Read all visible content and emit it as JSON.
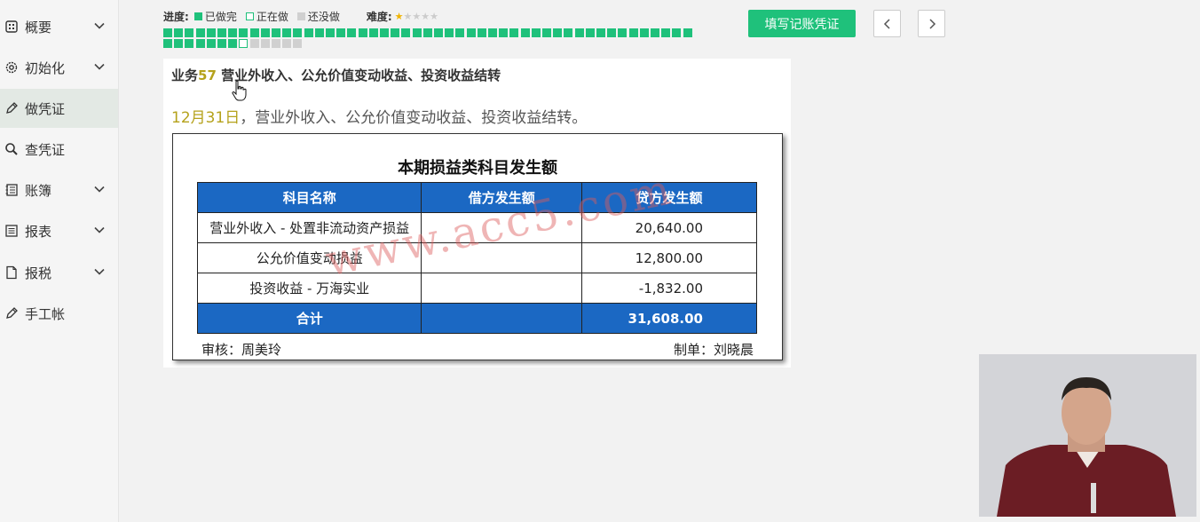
{
  "sidebar": {
    "items": [
      {
        "label": "概要",
        "icon": "overview-icon",
        "expandable": true
      },
      {
        "label": "初始化",
        "icon": "gear-icon",
        "expandable": true
      },
      {
        "label": "做凭证",
        "icon": "pen-icon",
        "expandable": false,
        "active": true
      },
      {
        "label": "查凭证",
        "icon": "search-icon",
        "expandable": false
      },
      {
        "label": "账簿",
        "icon": "ledger-icon",
        "expandable": true
      },
      {
        "label": "报表",
        "icon": "report-icon",
        "expandable": true
      },
      {
        "label": "报税",
        "icon": "document-icon",
        "expandable": true
      },
      {
        "label": "手工帐",
        "icon": "pen-icon",
        "expandable": false
      }
    ]
  },
  "progress": {
    "label": "进度:",
    "done_label": "已做完",
    "current_label": "正在做",
    "todo_label": "还没做",
    "difficulty_label": "难度:",
    "difficulty_stars": 1,
    "difficulty_max": 5,
    "total": 62,
    "done": 56,
    "current_index": 57,
    "colors": {
      "done": "#1fc17b",
      "todo": "#d0d0d0"
    }
  },
  "toolbar": {
    "fill_voucher_label": "填写记账凭证"
  },
  "task": {
    "title_prefix": "业务",
    "number": "57",
    "title_rest": " 营业外收入、公允价值变动收益、投资收益结转",
    "date": "12月31日",
    "description": "，营业外收入、公允价值变动收益、投资收益结转。"
  },
  "statement": {
    "title": "本期损益类科目发生额",
    "headers": [
      "科目名称",
      "借方发生额",
      "贷方发生额"
    ],
    "rows": [
      {
        "name": "营业外收入 - 处置非流动资产损益",
        "debit": "",
        "credit": "20,640.00"
      },
      {
        "name": "公允价值变动损益",
        "debit": "",
        "credit": "12,800.00"
      },
      {
        "name": "投资收益 - 万海实业",
        "debit": "",
        "credit": "-1,832.00"
      }
    ],
    "total": {
      "name": "合计",
      "debit": "",
      "credit": "31,608.00"
    },
    "reviewer": "审核：周美玲",
    "preparer": "制单：刘晓晨",
    "watermark": "www.acc5.com",
    "header_color": "#1b68c3"
  }
}
